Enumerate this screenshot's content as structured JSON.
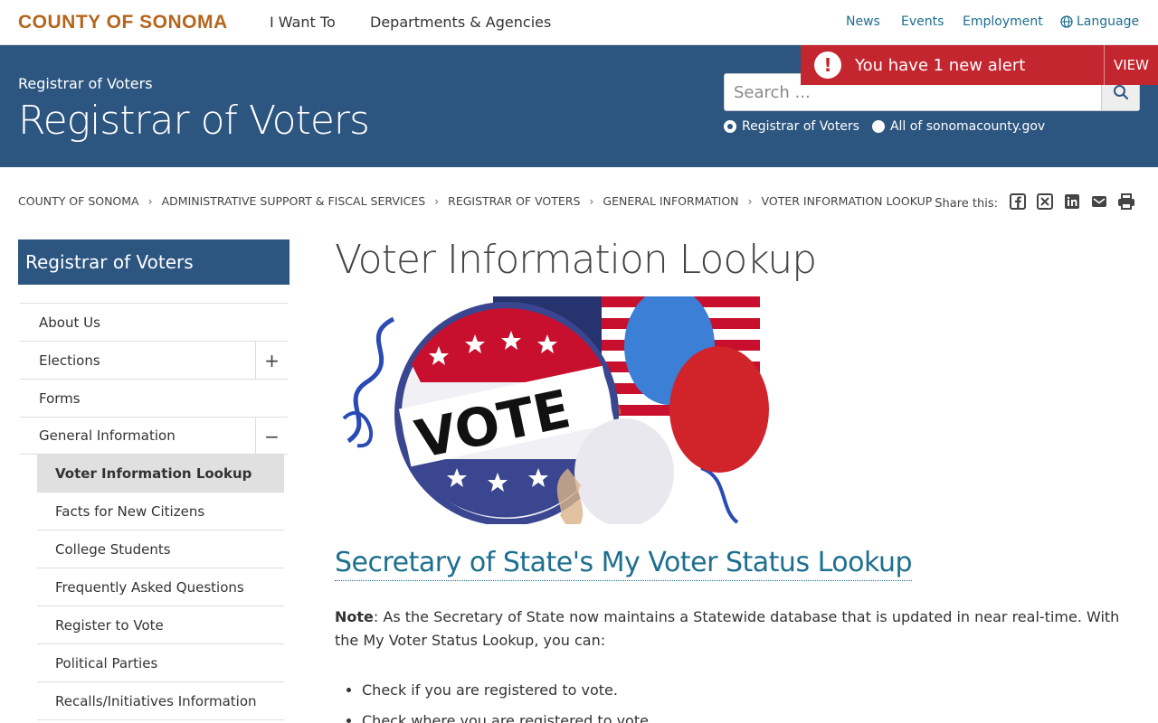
{
  "topnav": {
    "brand": "COUNTY OF SONOMA",
    "items": [
      "I Want To",
      "Departments & Agencies"
    ],
    "utility": [
      "News",
      "Events",
      "Employment"
    ],
    "language": "Language"
  },
  "alert": {
    "text": "You have 1 new alert",
    "view": "VIEW"
  },
  "header": {
    "subtitle": "Registrar of Voters",
    "title": "Registrar of Voters",
    "search_placeholder": "Search ...",
    "scope_options": [
      "Registrar of Voters",
      "All of sonomacounty.gov"
    ],
    "selected_scope": "Registrar of Voters"
  },
  "breadcrumb": [
    "COUNTY OF SONOMA",
    "ADMINISTRATIVE SUPPORT & FISCAL SERVICES",
    "REGISTRAR OF VOTERS",
    "GENERAL INFORMATION",
    "VOTER INFORMATION LOOKUP"
  ],
  "share": {
    "label": "Share this:",
    "icons": [
      "facebook-icon",
      "x-icon",
      "linkedin-icon",
      "email-icon",
      "print-icon"
    ]
  },
  "sidebar": {
    "heading": "Registrar of Voters",
    "items": [
      {
        "label": "About Us"
      },
      {
        "label": "Elections",
        "toggle": "+"
      },
      {
        "label": "Forms"
      },
      {
        "label": "General Information",
        "toggle": "−"
      }
    ],
    "subitems": [
      "Voter Information Lookup",
      "Facts for New Citizens",
      "College Students",
      "Frequently Asked Questions",
      "Register to Vote",
      "Political Parties",
      "Recalls/Initiatives Information"
    ],
    "active": "Voter Information Lookup"
  },
  "main": {
    "title": "Voter Information Lookup",
    "hero_text": "VOTE",
    "section_link": "Secretary of State's My Voter Status Lookup",
    "note_label": "Note",
    "note_text": ": As the Secretary of State now maintains a Statewide database that is updated in near real-time. With the My Voter Status Lookup, you can:",
    "bullets": [
      "Check if you are registered to vote.",
      "Check where you are registered to vote."
    ]
  },
  "colors": {
    "header_blue": "#2c5580",
    "brand_orange": "#b5651d",
    "link_teal": "#1d6f8f",
    "alert_red": "#c3262e"
  }
}
